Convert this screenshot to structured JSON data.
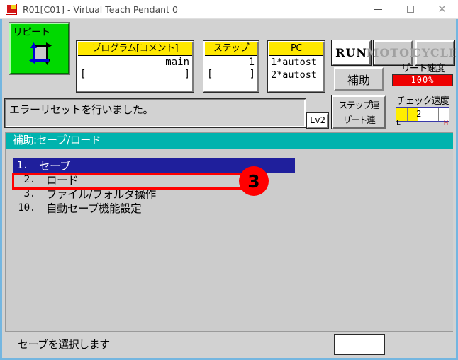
{
  "window": {
    "title": "R01[C01] - Virtual Teach Pendant 0",
    "icon": "kawasaki-logo-icon",
    "minimize_label": "—",
    "maximize_label": "□",
    "close_label": "✕"
  },
  "status_row": {
    "mode_button": {
      "label": "リピート",
      "icon": "repeat-cycle-icon",
      "color": "#00d900"
    },
    "program_panel": {
      "header": "プログラム[コメント]",
      "value": "main",
      "bracket_left": "[",
      "bracket_right": "]"
    },
    "step_panel": {
      "header": "ステップ゚",
      "value": "1",
      "bracket_left": "[",
      "bracket_right": "]"
    },
    "pc_panel": {
      "header": "PC",
      "line1": "1*autost",
      "line2": "2*autost"
    },
    "state_buttons": [
      {
        "label": "RUN",
        "active": true
      },
      {
        "label": "MOTOR",
        "active": false
      },
      {
        "label": "CYCLE",
        "active": false
      }
    ],
    "aux_button": "補助",
    "linked_button": {
      "line1": "ステップ゚連",
      "line2": "リ゚ート連"
    },
    "repeat_speed": {
      "label": "リ゚ート速度",
      "value": "100%",
      "percent": 100,
      "color": "#ee0000"
    },
    "check_speed": {
      "label": "チェック速度",
      "value": "2",
      "percent": 40,
      "low_label": "L",
      "high_label": "H",
      "color": "#ffee00"
    }
  },
  "message_bar": {
    "text": "エラーリセットを行いました。",
    "level_badge": "Lv2"
  },
  "screen": {
    "header": "補助:セーブ/ロード",
    "menu_items": [
      {
        "num": "1.",
        "label": "セーブ",
        "selected": true
      },
      {
        "num": "2.",
        "label": "ロード",
        "selected": false
      },
      {
        "num": "3.",
        "label": "ファイル/フォルダ操作",
        "selected": false
      },
      {
        "num": "10.",
        "label": "自動セーブ機能設定",
        "selected": false
      }
    ]
  },
  "annotation": {
    "step_number": "3",
    "highlight_color": "#ff0000"
  },
  "bottom_bar": {
    "text": "セーブを選択します",
    "input_value": ""
  }
}
